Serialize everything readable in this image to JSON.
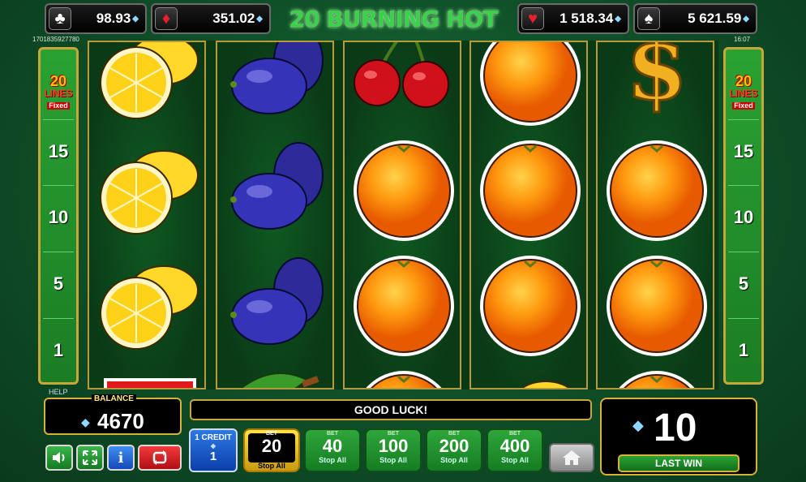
{
  "header": {
    "title": "20 BURNING HOT",
    "jackpots": [
      {
        "suit": "♣",
        "suit_color": "#ffffff",
        "value": "98.93"
      },
      {
        "suit": "♦",
        "suit_color": "#e8202a",
        "value": "351.02"
      },
      {
        "suit": "♥",
        "suit_color": "#e8202a",
        "value": "1 518.34"
      },
      {
        "suit": "♠",
        "suit_color": "#ffffff",
        "value": "5 621.59"
      }
    ],
    "session_id": "1701835927780",
    "clock": "16:07"
  },
  "lines_panel": {
    "count": "20",
    "word": "LINES",
    "fixed": "Fixed",
    "buttons": [
      "15",
      "10",
      "5",
      "1"
    ]
  },
  "reels": [
    [
      "lemon",
      "lemon",
      "lemon",
      "seven"
    ],
    [
      "plum",
      "plum",
      "plum",
      "watermelon"
    ],
    [
      "cherry",
      "orange",
      "orange",
      "orange"
    ],
    [
      "orange",
      "orange",
      "orange",
      "lemon"
    ],
    [
      "dollar",
      "orange",
      "orange",
      "orange"
    ]
  ],
  "bottom": {
    "help": "HELP",
    "balance_label": "BALANCE",
    "balance": "4670",
    "message": "GOOD LUCK!",
    "last_win": "10",
    "last_win_label": "LAST WIN",
    "credit": {
      "label": "1 CREDIT",
      "value": "1"
    },
    "bets": [
      {
        "label": "BET",
        "value": "20",
        "stop": "Stop All",
        "active": true
      },
      {
        "label": "BET",
        "value": "40",
        "stop": "Stop All",
        "active": false
      },
      {
        "label": "BET",
        "value": "100",
        "stop": "Stop All",
        "active": false
      },
      {
        "label": "BET",
        "value": "200",
        "stop": "Stop All",
        "active": false
      },
      {
        "label": "BET",
        "value": "400",
        "stop": "Stop All",
        "active": false
      }
    ],
    "icons": [
      "speaker-icon",
      "fullscreen-icon",
      "info-icon",
      "autoplay-icon",
      "home-icon"
    ]
  }
}
